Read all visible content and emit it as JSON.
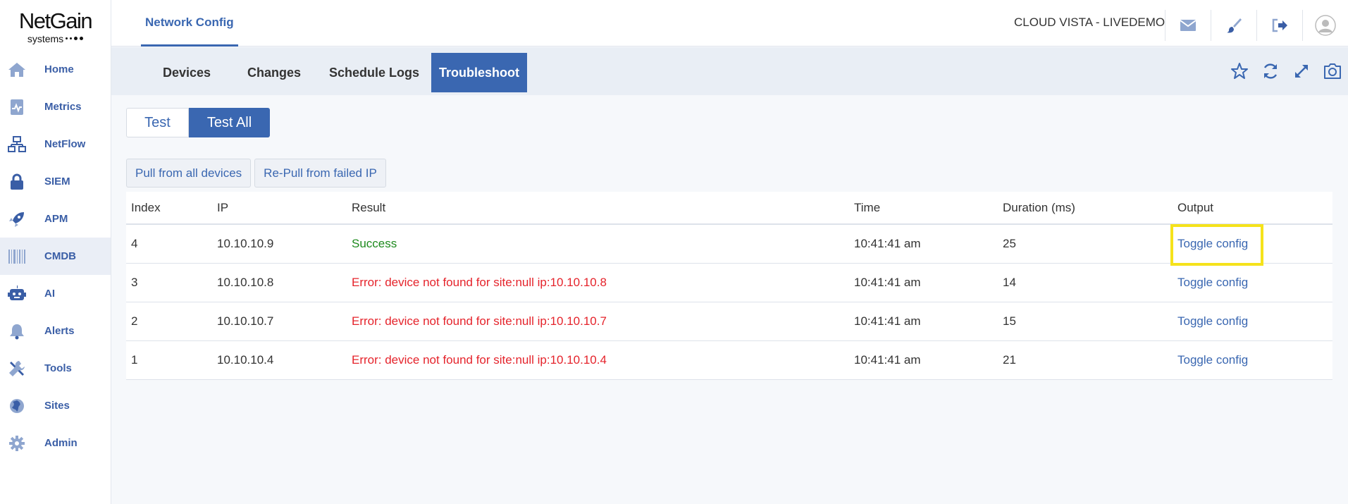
{
  "logo": {
    "name": "NetGain",
    "sub": "systems"
  },
  "sidebar": {
    "items": [
      {
        "label": "Home",
        "icon": "home-icon",
        "active": false
      },
      {
        "label": "Metrics",
        "icon": "metrics-icon",
        "active": false
      },
      {
        "label": "NetFlow",
        "icon": "netflow-icon",
        "active": false
      },
      {
        "label": "SIEM",
        "icon": "lock-icon",
        "active": false
      },
      {
        "label": "APM",
        "icon": "rocket-icon",
        "active": false
      },
      {
        "label": "CMDB",
        "icon": "barcode-icon",
        "active": true
      },
      {
        "label": "AI",
        "icon": "robot-icon",
        "active": false
      },
      {
        "label": "Alerts",
        "icon": "bell-icon",
        "active": false
      },
      {
        "label": "Tools",
        "icon": "tools-icon",
        "active": false
      },
      {
        "label": "Sites",
        "icon": "globe-icon",
        "active": false
      },
      {
        "label": "Admin",
        "icon": "gear-icon",
        "active": false
      }
    ]
  },
  "topbar": {
    "tab": "Network Config",
    "tenant": "CLOUD VISTA - LIVEDEMO",
    "icons": [
      "mail-icon",
      "brush-icon",
      "logout-icon",
      "avatar-icon"
    ]
  },
  "subtabs": [
    {
      "label": "Devices",
      "active": false
    },
    {
      "label": "Changes",
      "active": false
    },
    {
      "label": "Schedule Logs",
      "active": false
    },
    {
      "label": "Troubleshoot",
      "active": true
    }
  ],
  "subbar_icons": [
    "star-icon",
    "refresh-icon",
    "expand-icon",
    "camera-icon"
  ],
  "test_buttons": {
    "test": "Test",
    "test_all": "Test All"
  },
  "actions": {
    "pull_all": "Pull from all devices",
    "repull_failed": "Re-Pull from failed IP"
  },
  "table": {
    "headers": {
      "index": "Index",
      "ip": "IP",
      "result": "Result",
      "time": "Time",
      "duration": "Duration (ms)",
      "output": "Output"
    },
    "rows": [
      {
        "index": "4",
        "ip": "10.10.10.9",
        "result": "Success",
        "status": "success",
        "time": "10:41:41 am",
        "duration": "25",
        "output": "Toggle config"
      },
      {
        "index": "3",
        "ip": "10.10.10.8",
        "result": "Error: device not found for site:null ip:10.10.10.8",
        "status": "error",
        "time": "10:41:41 am",
        "duration": "14",
        "output": "Toggle config"
      },
      {
        "index": "2",
        "ip": "10.10.10.7",
        "result": "Error: device not found for site:null ip:10.10.10.7",
        "status": "error",
        "time": "10:41:41 am",
        "duration": "15",
        "output": "Toggle config"
      },
      {
        "index": "1",
        "ip": "10.10.10.4",
        "result": "Error: device not found for site:null ip:10.10.10.4",
        "status": "error",
        "time": "10:41:41 am",
        "duration": "21",
        "output": "Toggle config"
      }
    ]
  },
  "colors": {
    "accent": "#3a67b1",
    "success": "#1d8a1d",
    "error": "#e5232b",
    "highlight": "#f5e21b"
  }
}
